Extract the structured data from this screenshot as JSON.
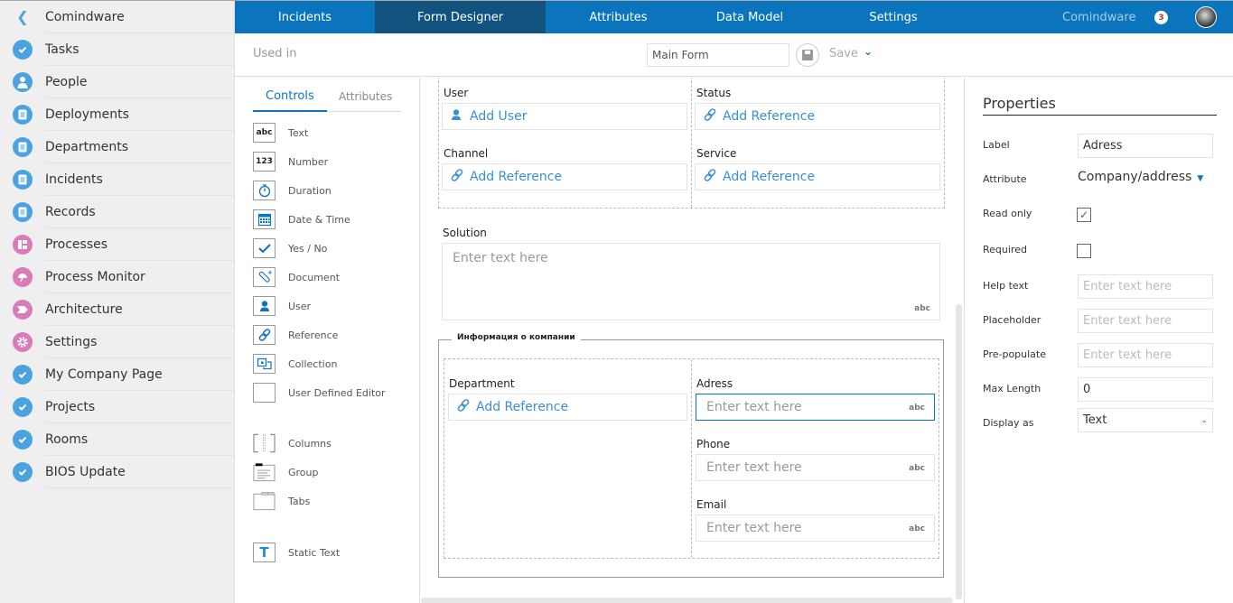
{
  "sidebar": {
    "back_label": "Comindware",
    "items": [
      {
        "label": "Tasks",
        "icon": "check-circle-icon",
        "color": "#4aa3df"
      },
      {
        "label": "People",
        "icon": "person-icon",
        "color": "#4aa3df"
      },
      {
        "label": "Deployments",
        "icon": "document-icon",
        "color": "#4aa3df"
      },
      {
        "label": "Departments",
        "icon": "document-icon",
        "color": "#4aa3df"
      },
      {
        "label": "Incidents",
        "icon": "document-icon",
        "color": "#4aa3df"
      },
      {
        "label": "Records",
        "icon": "document-icon",
        "color": "#4aa3df"
      },
      {
        "label": "Processes",
        "icon": "process-icon",
        "color": "#d97bb8"
      },
      {
        "label": "Process Monitor",
        "icon": "gauge-icon",
        "color": "#d97bb8"
      },
      {
        "label": "Architecture",
        "icon": "chevron-tag-icon",
        "color": "#d97bb8"
      },
      {
        "label": "Settings",
        "icon": "gear-icon",
        "color": "#d97bb8"
      },
      {
        "label": "My Company Page",
        "icon": "check-circle-icon",
        "color": "#4aa3df"
      },
      {
        "label": "Projects",
        "icon": "check-circle-icon",
        "color": "#4aa3df"
      },
      {
        "label": "Rooms",
        "icon": "check-circle-icon",
        "color": "#4aa3df"
      },
      {
        "label": "BIOS Update",
        "icon": "check-circle-icon",
        "color": "#4aa3df"
      }
    ]
  },
  "topnav": {
    "tabs": [
      {
        "label": "Incidents",
        "active": false
      },
      {
        "label": "Form Designer",
        "active": true
      },
      {
        "label": "Attributes",
        "active": false
      },
      {
        "label": "Data Model",
        "active": false
      },
      {
        "label": "Settings",
        "active": false
      }
    ],
    "brand": "Comindware",
    "notification_count": "3",
    "accent_color": "#0a74bd"
  },
  "toolbar": {
    "used_in_label": "Used in",
    "form_name_value": "Main Form",
    "save_label": "Save"
  },
  "controls_panel": {
    "tabs": {
      "controls": "Controls",
      "attributes": "Attributes"
    },
    "controls": [
      {
        "label": "Text",
        "icon": "text-abc-icon"
      },
      {
        "label": "Number",
        "icon": "number-123-icon"
      },
      {
        "label": "Duration",
        "icon": "stopwatch-icon"
      },
      {
        "label": "Date & Time",
        "icon": "calendar-icon"
      },
      {
        "label": "Yes / No",
        "icon": "checkmark-icon"
      },
      {
        "label": "Document",
        "icon": "paperclip-icon"
      },
      {
        "label": "User",
        "icon": "user-icon"
      },
      {
        "label": "Reference",
        "icon": "link-icon"
      },
      {
        "label": "Collection",
        "icon": "collection-icon"
      },
      {
        "label": "User Defined Editor",
        "icon": "blank-box-icon"
      }
    ],
    "layout_controls": [
      {
        "label": "Columns",
        "icon": "columns-icon"
      },
      {
        "label": "Group",
        "icon": "group-icon"
      },
      {
        "label": "Tabs",
        "icon": "tabs-icon"
      }
    ],
    "static_controls": [
      {
        "label": "Static Text",
        "icon": "static-text-icon"
      }
    ]
  },
  "canvas": {
    "fields_top": [
      {
        "label": "User",
        "action": "Add User",
        "type": "user"
      },
      {
        "label": "Status",
        "action": "Add Reference",
        "type": "reference"
      },
      {
        "label": "Channel",
        "action": "Add Reference",
        "type": "reference"
      },
      {
        "label": "Service",
        "action": "Add Reference",
        "type": "reference"
      }
    ],
    "solution": {
      "label": "Solution",
      "placeholder": "Enter text here",
      "badge": "abc"
    },
    "group": {
      "title": "Информация о компании",
      "department": {
        "label": "Department",
        "action": "Add Reference"
      },
      "text_fields": [
        {
          "label": "Adress",
          "placeholder": "Enter text here",
          "badge": "abc",
          "selected": true
        },
        {
          "label": "Phone",
          "placeholder": "Enter text here",
          "badge": "abc",
          "selected": false
        },
        {
          "label": "Email",
          "placeholder": "Enter text here",
          "badge": "abc",
          "selected": false
        }
      ]
    }
  },
  "properties": {
    "title": "Properties",
    "label": {
      "label": "Label",
      "value": "Adress"
    },
    "attribute": {
      "label": "Attribute",
      "value": "Company/address"
    },
    "read_only": {
      "label": "Read only",
      "checked": true
    },
    "required": {
      "label": "Required",
      "checked": false
    },
    "help_text": {
      "label": "Help text",
      "placeholder": "Enter text here"
    },
    "placeholder": {
      "label": "Placeholder",
      "placeholder": "Enter text here"
    },
    "pre_populate": {
      "label": "Pre-populate",
      "placeholder": "Enter text here"
    },
    "max_length": {
      "label": "Max Length",
      "value": "0"
    },
    "display_as": {
      "label": "Display as",
      "value": "Text"
    }
  }
}
